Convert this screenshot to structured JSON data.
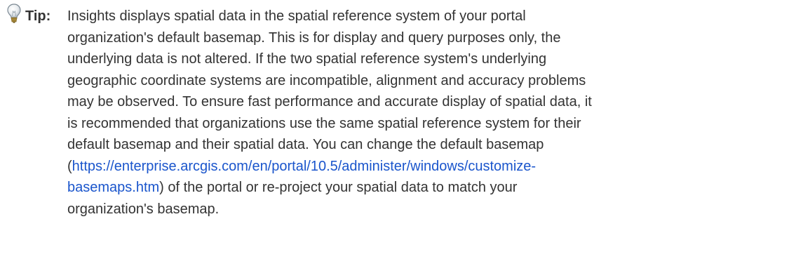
{
  "tip": {
    "icon": "lightbulb-icon",
    "label": "Tip:",
    "lines": {
      "l1": "Insights displays spatial data in the spatial reference system of your portal",
      "l2": "organization's default basemap. This is for display and query purposes only, the",
      "l3": "underlying data is not altered. If the two spatial reference system's underlying",
      "l4": "geographic coordinate systems are incompatible, alignment and accuracy problems",
      "l5": "may be observed. To ensure fast performance and accurate display of spatial data, it",
      "l6": "is recommended that organizations use the same spatial reference system for their",
      "l7": "default basemap and their spatial data. You can change the default basemap",
      "l8_open": "(",
      "l8_link": "https://enterprise.arcgis.com/en/portal/10.5/administer/windows/customize-",
      "l9_link": "basemaps.htm",
      "l9_rest": ") of the portal or re-project your spatial data to match your",
      "l10": "organization's basemap."
    },
    "colors": {
      "text": "#333333",
      "link": "#1a55cc"
    }
  }
}
